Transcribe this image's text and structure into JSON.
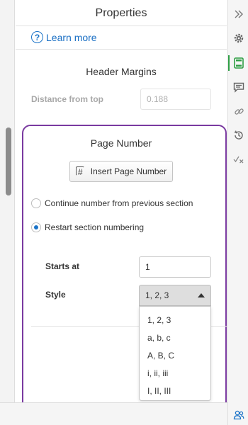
{
  "panel": {
    "title": "Properties",
    "learn_more": "Learn more"
  },
  "header_margins": {
    "heading": "Header Margins",
    "distance_label": "Distance from top",
    "distance_value": "0.188"
  },
  "page_number": {
    "heading": "Page Number",
    "insert_button": "Insert Page Number",
    "options": [
      {
        "label": "Continue number from previous section",
        "checked": false
      },
      {
        "label": "Restart section numbering",
        "checked": true
      }
    ],
    "starts_at_label": "Starts at",
    "starts_at_value": "1",
    "style_label": "Style",
    "style_value": "1, 2, 3",
    "style_options": [
      "1, 2, 3",
      "a, b, c",
      "A, B, C",
      "i, ii, iii",
      "I, II, III"
    ]
  },
  "colors": {
    "accent_blue": "#1a73c8",
    "highlight_purple": "#7a3aa0",
    "active_green": "#2e9e44"
  },
  "rail_icons": [
    "double-chevron-right-icon",
    "gear-icon",
    "header-footer-icon",
    "comment-icon",
    "link-icon",
    "history-icon",
    "checkmark-x-icon"
  ],
  "footer_icon": "people-icon"
}
